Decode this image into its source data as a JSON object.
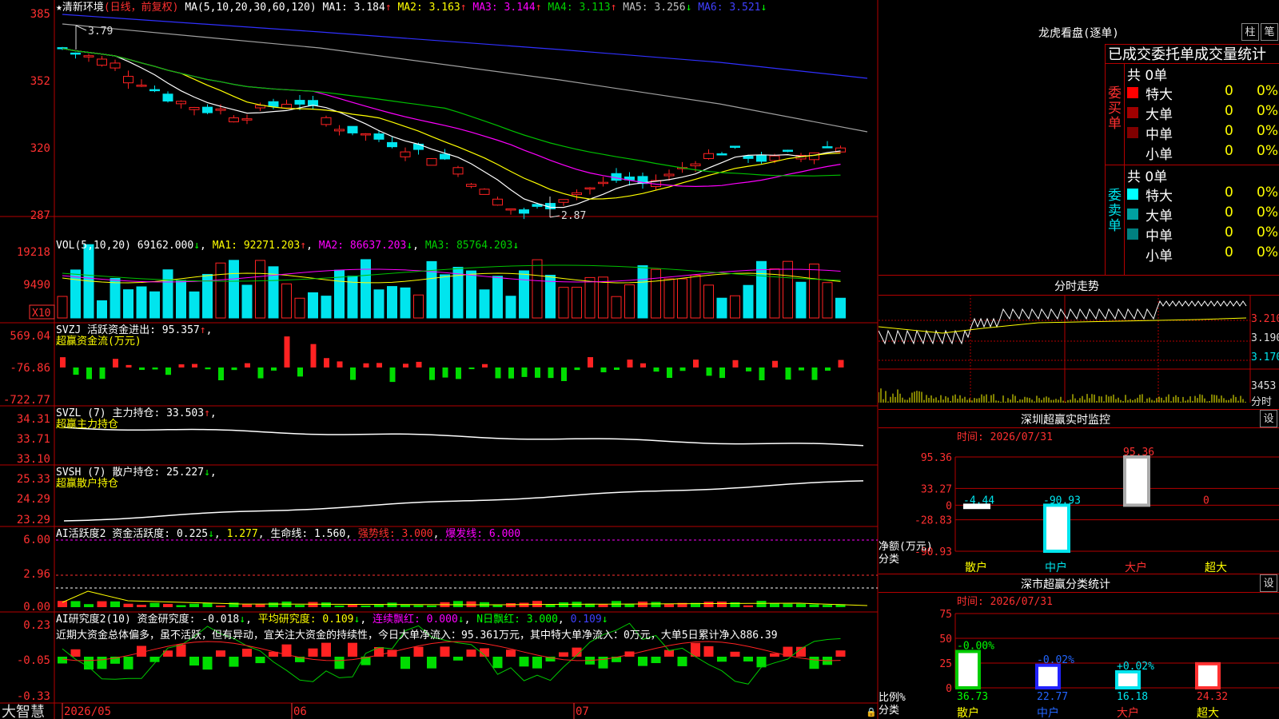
{
  "colors": {
    "up": "#ff2222",
    "down": "#00e5ee",
    "green": "#00dd00",
    "grid": "#b40000",
    "ma1": "#ffffff",
    "ma2": "#ffff00",
    "ma3": "#ff00ff",
    "ma4": "#00c000",
    "ma5": "#a0a0a0",
    "ma6": "#3030ff"
  },
  "brand": "大智慧",
  "stock": {
    "star": "★",
    "name": "清新环境",
    "period": "(日线，前复权)"
  },
  "ma_header": {
    "params": "MA(5,10,20,30,60,120)",
    "items": [
      {
        "label": "MA1: 3.184",
        "arrow": "↑"
      },
      {
        "label": "MA2: 3.163",
        "arrow": "↑"
      },
      {
        "label": "MA3: 3.144",
        "arrow": "↑"
      },
      {
        "label": "MA4: 3.113",
        "arrow": "↑"
      },
      {
        "label": "MA5: 3.256",
        "arrow": "↓"
      },
      {
        "label": "MA6: 3.521",
        "arrow": "↓"
      }
    ]
  },
  "price_axis": [
    "385",
    "352",
    "320",
    "287"
  ],
  "price_marks": {
    "high": "3.79",
    "low": "2.87"
  },
  "vol_header": {
    "params": "VOL(5,10,20)",
    "v": "69162.000",
    "ma1": "MA1: 92271.203",
    "ma2": "MA2: 86637.203",
    "ma3": "MA3: 85764.203"
  },
  "vol_axis": [
    "19218",
    "9490"
  ],
  "vol_unit": "X10",
  "svzj": {
    "title": "SVZJ  活跃资金进出: 95.357",
    "sub": "超赢资金流(万元)",
    "axis": [
      "569.04",
      "-76.86",
      "-722.77"
    ]
  },
  "svzl": {
    "title": "SVZL (7) 主力持仓: 33.503",
    "sub": "超赢主力持仓",
    "axis": [
      "34.31",
      "33.71",
      "33.10"
    ]
  },
  "svsh": {
    "title": "SVSH (7) 散户持仓: 25.227",
    "sub": "超赢散户持仓",
    "axis": [
      "25.33",
      "24.29",
      "23.29"
    ]
  },
  "ai1": {
    "a": "AI活跃度2 资金活跃度: 0.225",
    "b": "1.277",
    "c": "生命线: 1.560",
    "d": "强势线: 3.000",
    "e": "爆发线: 6.000",
    "axis": [
      "6.00",
      "2.96",
      "0.00"
    ]
  },
  "ai2": {
    "a": "AI研究度2(10) 资金研究度: -0.018",
    "b": "平均研究度: 0.109",
    "c": "连续飘红: 0.000",
    "d": "N日飘红: 3.000",
    "e": "0.109",
    "note": "近期大资金总体偏多，虽不活跃，但有异动，宜关注大资金的持续性，今日大单净流入：95.361万元，其中特大单净流入：0万元，大单5日累计净入886.39",
    "axis": [
      "0.23",
      "-0.05",
      "-0.33"
    ]
  },
  "dates": [
    "2026/05",
    "06",
    "07"
  ],
  "lhb": {
    "title": "龙虎看盘(逐单)",
    "btn1": "柱",
    "btn2": "笔",
    "header": "已成交委托单成交量统计",
    "buy": {
      "label": "委买单",
      "total": "共 0单",
      "rows": [
        [
          "特大",
          "0",
          "0%"
        ],
        [
          "大单",
          "0",
          "0%"
        ],
        [
          "中单",
          "0",
          "0%"
        ],
        [
          "小单",
          "0",
          "0%"
        ]
      ]
    },
    "sell": {
      "label": "委卖单",
      "total": "共 0单",
      "rows": [
        [
          "特大",
          "0",
          "0%"
        ],
        [
          "大单",
          "0",
          "0%"
        ],
        [
          "中单",
          "0",
          "0%"
        ],
        [
          "小单",
          "0",
          "0%"
        ]
      ]
    }
  },
  "fenshi": {
    "title": "分时走势",
    "axis": [
      "3.210",
      "3.190",
      "3.170"
    ],
    "vol_max": "3453",
    "vol_unit": "分时"
  },
  "monitor": {
    "title": "深圳超赢实时监控",
    "btn": "设",
    "time": "时间: 2026/07/31",
    "axis": [
      "95.36",
      "33.27",
      "0",
      "-28.83",
      "-90.93"
    ],
    "ylabel": "净额(万元)",
    "xlabel": "分类",
    "chart_data": {
      "type": "bar",
      "categories": [
        "散户",
        "中户",
        "大户",
        "超大"
      ],
      "values": [
        -4.44,
        -90.93,
        95.36,
        0
      ],
      "labels": [
        "-4.44",
        "-90.93",
        "95.36",
        "0"
      ],
      "ylim": [
        -90.93,
        95.36
      ]
    }
  },
  "classstat": {
    "title": "深市超赢分类统计",
    "btn": "设",
    "time": "时间: 2026/07/31",
    "axis": [
      "75",
      "50",
      "25",
      "0"
    ],
    "ylabel": "比例%",
    "xlabel": "分类",
    "chart_data": {
      "type": "bar",
      "categories": [
        "散户",
        "中户",
        "大户",
        "超大"
      ],
      "values": [
        36.73,
        22.77,
        16.18,
        24.32
      ],
      "changes": [
        "-0.00%",
        "-0.02%",
        "+0.02%",
        ""
      ],
      "ylim": [
        0,
        75
      ]
    }
  }
}
